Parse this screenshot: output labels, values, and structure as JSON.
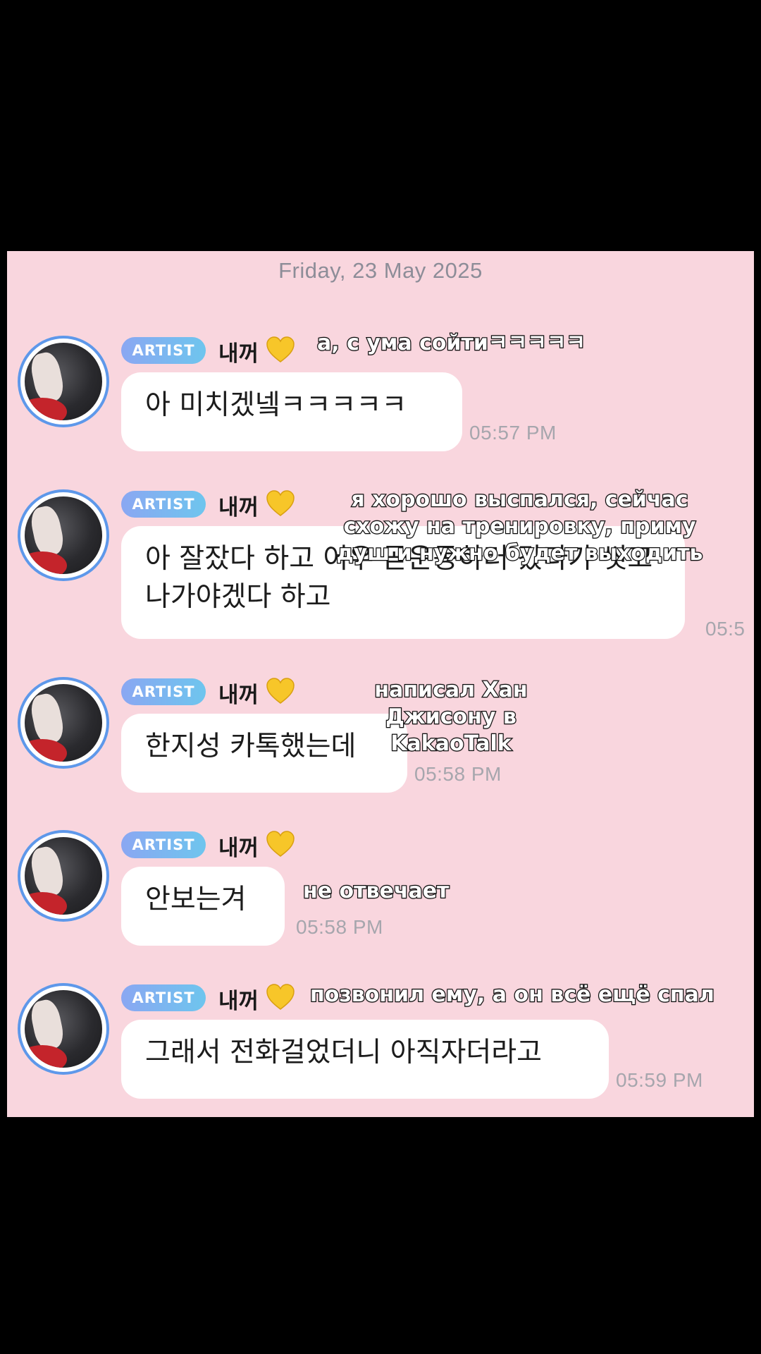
{
  "chat": {
    "date": "Friday, 23 May 2025",
    "badge_label": "ARTIST",
    "sender_name": "내꺼",
    "heart_icon": "yellow-heart-icon",
    "messages": [
      {
        "text": "아 미치겠넼ㅋㅋㅋㅋㅋ",
        "time": "05:57 PM",
        "caption": "а, с ума сойтиㅋㅋㅋㅋㅋ"
      },
      {
        "text": "아 잘잤다 하고 어우 곧운동하러 갔다가 씻고 나가야겠다 하고",
        "time": "05:5",
        "caption": "я хорошо выспался, сейчас схожу на тренировку, приму душ и нужно будет выходить"
      },
      {
        "text": "한지성 카톡했는데",
        "time": "05:58 PM",
        "caption": "написал Хан Джисону в KakaoTalk"
      },
      {
        "text": "안보는겨",
        "time": "05:58 PM",
        "caption": "не отвечает"
      },
      {
        "text": "그래서 전화걸었더니 아직자더라고",
        "time": "05:59 PM",
        "caption": "позвонил ему, а он всё ещё спал"
      }
    ]
  },
  "colors": {
    "chat_background": "#f9d6de",
    "bubble": "#ffffff",
    "avatar_ring": "#5e98ea",
    "badge_gradient_start": "#8aa7f2",
    "badge_gradient_end": "#6ec5ee",
    "time_text": "#a6a6ad"
  }
}
